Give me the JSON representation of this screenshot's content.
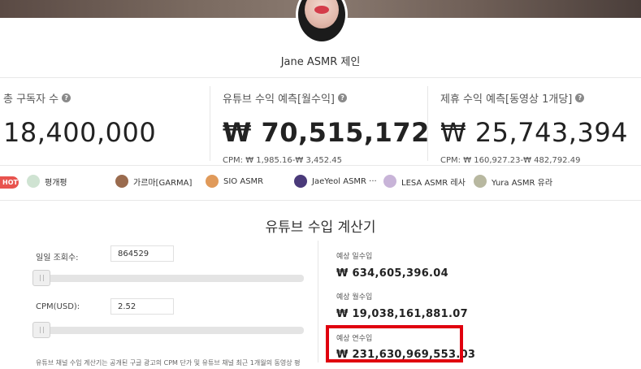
{
  "channel": {
    "name": "Jane ASMR 제인"
  },
  "stats": {
    "subscribers": {
      "label": "총 구독자 수",
      "value": "18,400,000"
    },
    "youtube_revenue": {
      "label": "유튜브 수익 예측[월수익]",
      "value": "₩ 70,515,172",
      "cpm": "CPM: ₩ 1,985.16-₩ 3,452.45"
    },
    "sponsorship": {
      "label": "제휴 수익 예측[동영상 1개당]",
      "value": "₩ 25,743,394",
      "cpm": "CPM: ₩ 160,927.23-₩ 482,792.49"
    }
  },
  "hot_badge": "HOT",
  "related_channels": [
    {
      "name": "평개평",
      "color": "#cfe3d2"
    },
    {
      "name": "가르마[GARMA]",
      "color": "#9a6b4e"
    },
    {
      "name": "SIO ASMR",
      "color": "#e09a5a"
    },
    {
      "name": "JaeYeol ASMR ···",
      "color": "#4a3a7a"
    },
    {
      "name": "LESA ASMR 레사",
      "color": "#c8b4d8"
    },
    {
      "name": "Yura ASMR 유라",
      "color": "#b8b8a0"
    }
  ],
  "calculator": {
    "title": "유튜브 수입 계산기",
    "daily_views_label": "일일 조회수:",
    "daily_views_value": "864529",
    "daily_views_level": 0.01,
    "cpm_label": "CPM(USD):",
    "cpm_value": "2.52",
    "cpm_level": 0.01,
    "note": "유튜브 채널 수입 계산기는 공개된 구글 광고의 CPM 단가 및 유튜브 채널 최근 1개월의 동영상 평",
    "results": {
      "daily_label": "예상 일수입",
      "daily_value": "₩ 634,605,396.04",
      "monthly_label": "예상 월수입",
      "monthly_value": "₩ 19,038,161,881.07",
      "yearly_label": "예상 연수입",
      "yearly_value": "₩ 231,630,969,553.03"
    }
  },
  "colors": {
    "highlight": "#e0000e",
    "hot": "#e8534e"
  },
  "icons": {
    "help": "question-circle-icon"
  }
}
